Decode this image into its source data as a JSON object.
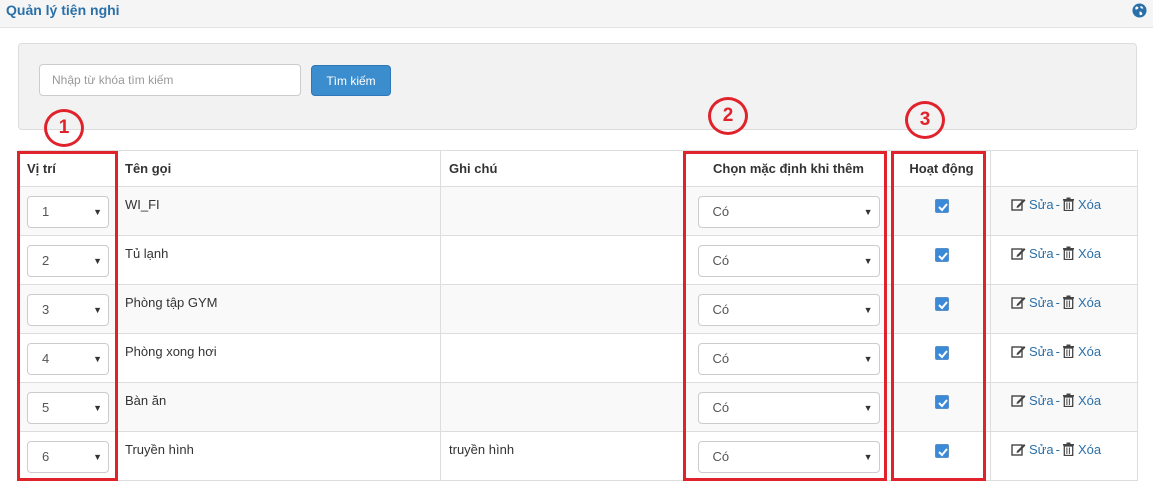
{
  "header": {
    "title": "Quản lý tiện nghi"
  },
  "search": {
    "placeholder": "Nhập từ khóa tìm kiếm",
    "value": "",
    "button_label": "Tìm kiếm"
  },
  "table": {
    "columns": {
      "position": "Vị trí",
      "name": "Tên gọi",
      "note": "Ghi chú",
      "default_on_add": "Chọn mặc định khi thêm",
      "active": "Hoạt động",
      "actions": ""
    },
    "rows": [
      {
        "position": "1",
        "name": "WI_FI",
        "note": "",
        "default_on_add": "Có",
        "active": true
      },
      {
        "position": "2",
        "name": "Tủ lạnh",
        "note": "",
        "default_on_add": "Có",
        "active": true
      },
      {
        "position": "3",
        "name": "Phòng tập GYM",
        "note": "",
        "default_on_add": "Có",
        "active": true
      },
      {
        "position": "4",
        "name": "Phòng xong hơi",
        "note": "",
        "default_on_add": "Có",
        "active": true
      },
      {
        "position": "5",
        "name": "Bàn ăn",
        "note": "",
        "default_on_add": "Có",
        "active": true
      },
      {
        "position": "6",
        "name": "Truyền hình",
        "note": "truyền hình",
        "default_on_add": "Có",
        "active": true
      }
    ],
    "edit_label": "Sửa",
    "separator": "-",
    "delete_label": "Xóa"
  },
  "annotations": {
    "marker_1": "1",
    "marker_2": "2",
    "marker_3": "3"
  },
  "colors": {
    "accent": "#2a6fa8",
    "button": "#3c8dcd",
    "annotation": "#e0232b",
    "checkbox": "#3b8ad8"
  },
  "icons": {
    "header": "globe-icon",
    "edit": "edit-icon",
    "delete": "trash-icon",
    "select": "caret-down-icon",
    "check": "checkmark-icon"
  }
}
